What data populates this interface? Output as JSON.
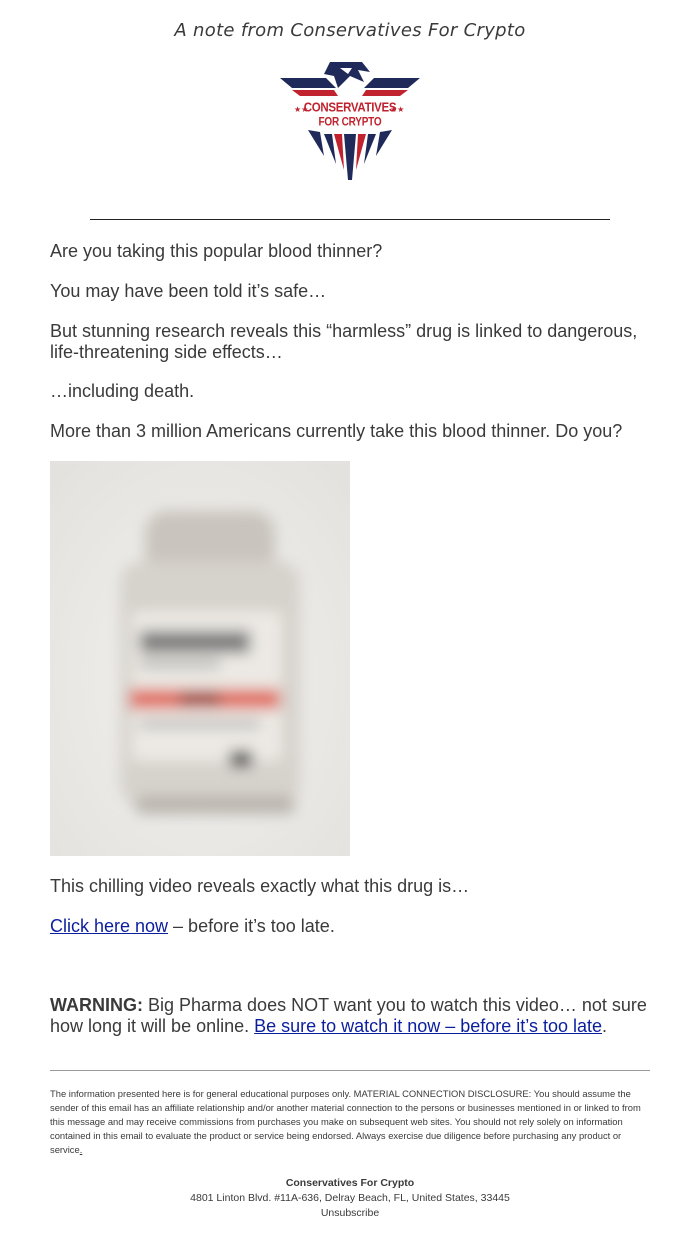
{
  "header": {
    "note": "A note from Conservatives For Crypto"
  },
  "logo": {
    "line1": "CONSERVATIVES",
    "line2": "FOR CRYPTO",
    "navy": "#1f2a5a",
    "red": "#c0232e"
  },
  "body": {
    "p1": "Are you taking this popular blood thinner?",
    "p2": "You may have been told it’s safe…",
    "p3": "But stunning research reveals this “harmless” drug is linked to dangerous, life-threatening side effects…",
    "p4": "…including death.",
    "p5": "More than 3 million Americans currently take this blood thinner. Do you?",
    "p6": "This chilling video reveals exactly what this drug is…",
    "cta_link": "Click here now",
    "cta_rest": " – before it’s too late.",
    "warning_label": "WARNING:",
    "warning_text": " Big Pharma does NOT want you to watch this video… not sure how long it will be online. ",
    "warning_link": "Be sure to watch it now – before it’s too late",
    "warning_end": "."
  },
  "disclaimer": {
    "text": "The information presented here is for general educational purposes only. MATERIAL CONNECTION DISCLOSURE: You should assume the sender of this email has an affiliate relationship and/or another material connection to the persons or businesses mentioned in or linked to from this message and may receive commissions from purchases you make on subsequent web sites. You should not rely solely on information contained in this email to evaluate the product or service being endorsed. Always exercise due diligence before purchasing any product or service",
    "end_link": "."
  },
  "footer": {
    "company": "Conservatives For Crypto",
    "address": "4801 Linton Blvd. #11A-636, Delray Beach, FL, United States, 33445",
    "unsubscribe": "Unsubscribe"
  },
  "colors": {
    "text": "#3a3a3a",
    "link": "#0b1f9e"
  }
}
